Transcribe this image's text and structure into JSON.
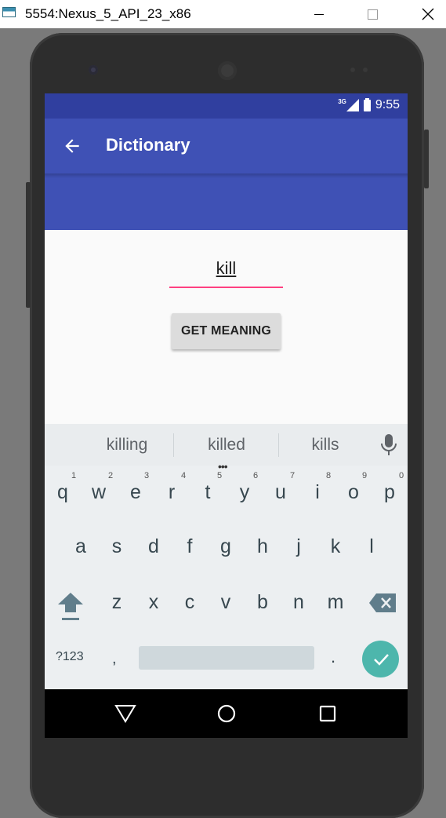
{
  "window": {
    "title": "5554:Nexus_5_API_23_x86",
    "controls": {
      "minimize": "minimize-icon",
      "maximize": "maximize-icon",
      "close": "close-icon"
    }
  },
  "status_bar": {
    "network": "3G",
    "time": "9:55",
    "color": "#303f9f"
  },
  "app_bar": {
    "title": "Dictionary",
    "back_icon": "arrow-back-icon",
    "color": "#3f51b5"
  },
  "form": {
    "word_value": "kill",
    "underline_color": "#ff4081",
    "button_label": "GET MEANING"
  },
  "keyboard": {
    "suggestions": [
      "killing",
      "killed",
      "kills"
    ],
    "more_indicator": "•••",
    "row1": [
      {
        "key": "q",
        "hint": "1"
      },
      {
        "key": "w",
        "hint": "2"
      },
      {
        "key": "e",
        "hint": "3"
      },
      {
        "key": "r",
        "hint": "4"
      },
      {
        "key": "t",
        "hint": "5"
      },
      {
        "key": "y",
        "hint": "6"
      },
      {
        "key": "u",
        "hint": "7"
      },
      {
        "key": "i",
        "hint": "8"
      },
      {
        "key": "o",
        "hint": "9"
      },
      {
        "key": "p",
        "hint": "0"
      }
    ],
    "row2": [
      "a",
      "s",
      "d",
      "f",
      "g",
      "h",
      "j",
      "k",
      "l"
    ],
    "row3": [
      "z",
      "x",
      "c",
      "v",
      "b",
      "n",
      "m"
    ],
    "bottom": {
      "mode": "?123",
      "comma": ",",
      "period": "."
    },
    "enter_color": "#4db6ac"
  },
  "nav_bar": {
    "back": "nav-back-icon",
    "home": "nav-home-icon",
    "recents": "nav-recents-icon"
  }
}
